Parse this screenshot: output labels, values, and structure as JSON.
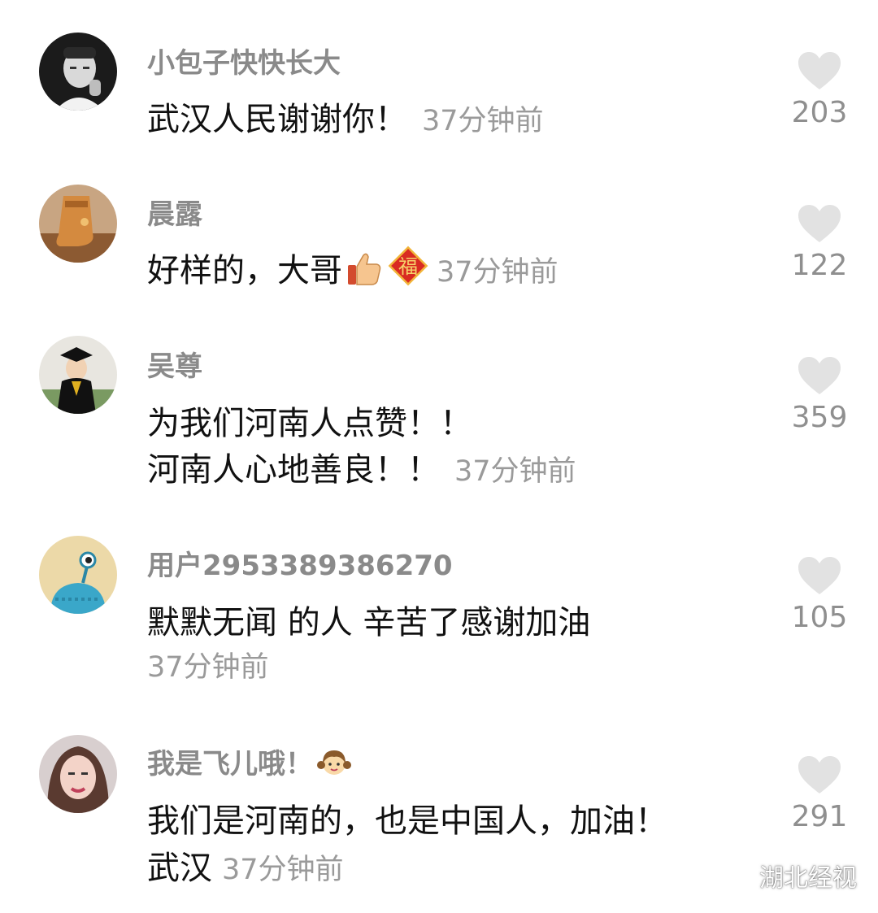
{
  "comments": [
    {
      "username": "小包子快快长大",
      "lines": [
        "武汉人民谢谢你！"
      ],
      "time": "37分钟前",
      "likes": "203"
    },
    {
      "username": "晨露",
      "lines": [
        "好样的，大哥"
      ],
      "time": "37分钟前",
      "likes": "122"
    },
    {
      "username": "吴尊",
      "lines": [
        "为我们河南人点赞！！",
        "河南人心地善良！！"
      ],
      "time": "37分钟前",
      "likes": "359"
    },
    {
      "username": "用户2953389386270",
      "lines": [
        "默默无闻 的人 辛苦了感谢加油"
      ],
      "time": "37分钟前",
      "likes": "105"
    },
    {
      "username": "我是飞儿哦！",
      "lines": [
        "我们是河南的，也是中国人，加油！",
        "武汉"
      ],
      "time": "37分钟前",
      "likes": "291"
    }
  ],
  "emoji_fu": "福",
  "watermark": "湖北经视",
  "icons": {
    "like": "heart-icon",
    "thumbs_up": "thumbs-up-emoji",
    "fu": "fu-emoji",
    "girl": "girl-emoji",
    "wechat": "wechat-icon"
  },
  "colors": {
    "username": "#8a8a8a",
    "text": "#111111",
    "time": "#9a9a9a",
    "heart": "#e2e2e2",
    "count": "#8f8f8f"
  }
}
